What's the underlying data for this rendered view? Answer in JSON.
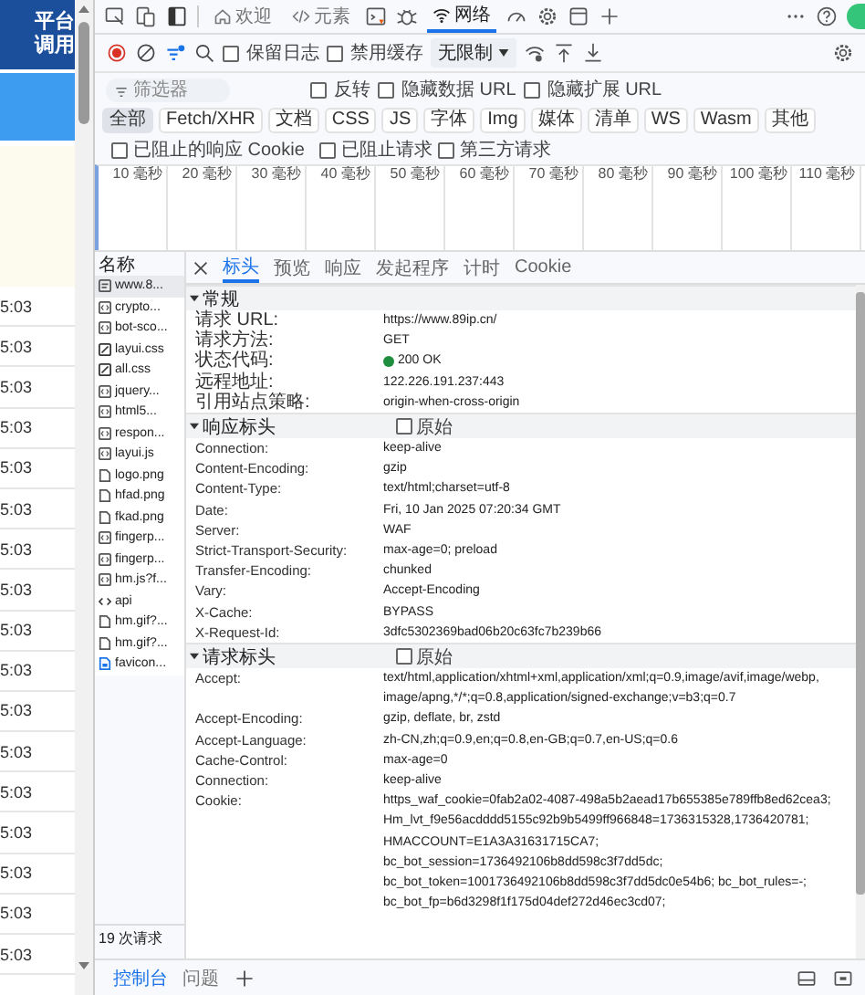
{
  "page_behind": {
    "header_lines": [
      "平台",
      "调用"
    ],
    "times": [
      "5:03",
      "5:03",
      "5:03",
      "5:03",
      "5:03",
      "5:03",
      "5:03",
      "5:03",
      "5:03",
      "5:03",
      "5:03",
      "5:03",
      "5:03",
      "5:03",
      "5:03",
      "5:03",
      "5:03"
    ]
  },
  "top_tabs": [
    {
      "label": "欢迎",
      "selected": false
    },
    {
      "label": "元素",
      "selected": false
    },
    {
      "label": "网络",
      "selected": true
    }
  ],
  "toolbar": {
    "recording": true,
    "options": [
      {
        "label": "保留日志",
        "checked": false
      },
      {
        "label": "禁用缓存",
        "checked": false
      }
    ],
    "throttling": "无限制"
  },
  "filter": {
    "placeholder": "筛选器",
    "options": [
      {
        "label": "反转",
        "checked": false
      },
      {
        "label": "隐藏数据 URL",
        "checked": false
      },
      {
        "label": "隐藏扩展 URL",
        "checked": false
      }
    ]
  },
  "type_filters": [
    {
      "label": "全部",
      "selected": true
    },
    {
      "label": "Fetch/XHR",
      "selected": false
    },
    {
      "label": "文档",
      "selected": false
    },
    {
      "label": "CSS",
      "selected": false
    },
    {
      "label": "JS",
      "selected": false
    },
    {
      "label": "字体",
      "selected": false
    },
    {
      "label": "Img",
      "selected": false
    },
    {
      "label": "媒体",
      "selected": false
    },
    {
      "label": "清单",
      "selected": false
    },
    {
      "label": "WS",
      "selected": false
    },
    {
      "label": "Wasm",
      "selected": false
    },
    {
      "label": "其他",
      "selected": false
    }
  ],
  "extra_filters": [
    {
      "label": "已阻止的响应 Cookie",
      "checked": false
    },
    {
      "label": "已阻止请求",
      "checked": false
    },
    {
      "label": "第三方请求",
      "checked": false
    }
  ],
  "overview_ticks": [
    "10 毫秒",
    "20 毫秒",
    "30 毫秒",
    "40 毫秒",
    "50 毫秒",
    "60 毫秒",
    "70 毫秒",
    "80 毫秒",
    "90 毫秒",
    "100 毫秒",
    "110 毫秒"
  ],
  "requests": {
    "header": "名称",
    "items": [
      {
        "name": "www.8...",
        "kind": "doc",
        "selected": true
      },
      {
        "name": "crypto...",
        "kind": "script",
        "selected": false
      },
      {
        "name": "bot-sco...",
        "kind": "script",
        "selected": false
      },
      {
        "name": "layui.css",
        "kind": "css",
        "selected": false
      },
      {
        "name": "all.css",
        "kind": "css",
        "selected": false
      },
      {
        "name": "jquery...",
        "kind": "script",
        "selected": false
      },
      {
        "name": "html5...",
        "kind": "script",
        "selected": false
      },
      {
        "name": "respon...",
        "kind": "script",
        "selected": false
      },
      {
        "name": "layui.js",
        "kind": "script",
        "selected": false
      },
      {
        "name": "logo.png",
        "kind": "image",
        "selected": false
      },
      {
        "name": "hfad.png",
        "kind": "image",
        "selected": false
      },
      {
        "name": "fkad.png",
        "kind": "image",
        "selected": false
      },
      {
        "name": "fingerp...",
        "kind": "script",
        "selected": false
      },
      {
        "name": "fingerp...",
        "kind": "script",
        "selected": false
      },
      {
        "name": "hm.js?f...",
        "kind": "script",
        "selected": false
      },
      {
        "name": "api",
        "kind": "fetch",
        "selected": false
      },
      {
        "name": "hm.gif?...",
        "kind": "image",
        "selected": false
      },
      {
        "name": "hm.gif?...",
        "kind": "image",
        "selected": false
      },
      {
        "name": "favicon...",
        "kind": "favicon",
        "selected": false
      }
    ],
    "summary": "19 次请求"
  },
  "detail_tabs": [
    {
      "label": "标头",
      "selected": true
    },
    {
      "label": "预览",
      "selected": false
    },
    {
      "label": "响应",
      "selected": false
    },
    {
      "label": "发起程序",
      "selected": false
    },
    {
      "label": "计时",
      "selected": false
    },
    {
      "label": "Cookie",
      "selected": false
    }
  ],
  "sections": [
    {
      "title": "常规",
      "expanded": true,
      "rows": [
        {
          "key": "请求 URL:",
          "value": "https://www.89ip.cn/"
        },
        {
          "key": "请求方法:",
          "value": "GET"
        },
        {
          "key": "状态代码:",
          "value": "200 OK",
          "color": "#1e8e3e"
        },
        {
          "key": "远程地址:",
          "value": "122.226.191.237:443"
        },
        {
          "key": "引用站点策略:",
          "value": "origin-when-cross-origin"
        }
      ]
    },
    {
      "title": "响应标头",
      "expanded": true,
      "raw": {
        "label": "原始",
        "checked": false
      },
      "rows": [
        {
          "key": "Connection:",
          "value": "keep-alive"
        },
        {
          "key": "Content-Encoding:",
          "value": "gzip"
        },
        {
          "key": "Content-Type:",
          "value": "text/html;charset=utf-8"
        },
        {
          "key": "Date:",
          "value": "Fri, 10 Jan 2025 07:20:34 GMT"
        },
        {
          "key": "Server:",
          "value": "WAF"
        },
        {
          "key": "Strict-Transport-Security:",
          "value": "max-age=0; preload"
        },
        {
          "key": "Transfer-Encoding:",
          "value": "chunked"
        },
        {
          "key": "Vary:",
          "value": "Accept-Encoding"
        },
        {
          "key": "X-Cache:",
          "value": "BYPASS"
        },
        {
          "key": "X-Request-Id:",
          "value": "3dfc5302369bad06b20c63fc7b239b66"
        }
      ]
    },
    {
      "title": "请求标头",
      "expanded": true,
      "raw": {
        "label": "原始",
        "checked": false
      },
      "rows": [
        {
          "key": "Accept:",
          "lines": [
            "text/html,application/xhtml+xml,application/xml;q=0.9,image/avif,image/webp,",
            "image/apng,*/*;q=0.8,application/signed-exchange;v=b3;q=0.7"
          ]
        },
        {
          "key": "Accept-Encoding:",
          "value": "gzip, deflate, br, zstd"
        },
        {
          "key": "Accept-Language:",
          "value": "zh-CN,zh;q=0.9,en;q=0.8,en-GB;q=0.7,en-US;q=0.6"
        },
        {
          "key": "Cache-Control:",
          "value": "max-age=0"
        },
        {
          "key": "Connection:",
          "value": "keep-alive"
        },
        {
          "key": "Cookie:",
          "lines": [
            "https_waf_cookie=0fab2a02-4087-498a5b2aead17b655385e789ffb8ed62cea3;",
            "Hm_lvt_f9e56acdddd5155c92b9b5499ff966848=1736315328,1736420781;",
            "HMACCOUNT=E1A3A31631715CA7;",
            "bc_bot_session=1736492106b8dd598c3f7dd5dc;",
            "bc_bot_token=1001736492106b8dd598c3f7dd5dc0e54b6; bc_bot_rules=-;",
            "bc_bot_fp=b6d3298f1f175d04def272d46ec3cd07;"
          ]
        }
      ]
    }
  ],
  "drawer_tabs": [
    {
      "label": "控制台",
      "selected": true
    },
    {
      "label": "问题",
      "selected": false
    }
  ]
}
